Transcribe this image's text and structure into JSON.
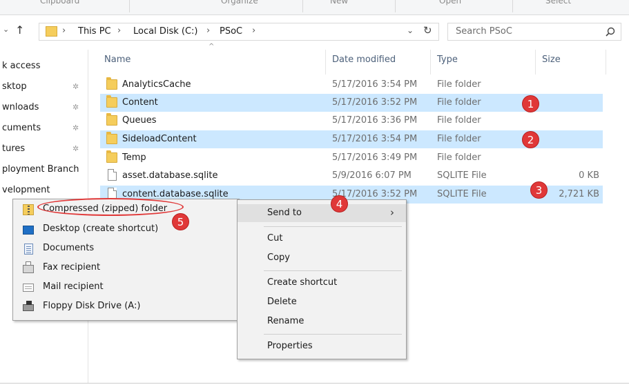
{
  "ribbon": {
    "groups": [
      "Clipboard",
      "Organize",
      "New",
      "Open",
      "Select"
    ]
  },
  "address": {
    "crumbs": [
      "This PC",
      "Local Disk (C:)",
      "PSoC"
    ],
    "separator": "›",
    "search_placeholder": "Search PSoC"
  },
  "nav": {
    "items": [
      "k access",
      "sktop",
      "wnloads",
      "cuments",
      "tures",
      "ployment Branch",
      "velopment"
    ]
  },
  "columns": {
    "name": "Name",
    "date": "Date modified",
    "type": "Type",
    "size": "Size"
  },
  "files": [
    {
      "name": "AnalyticsCache",
      "date": "5/17/2016 3:54 PM",
      "type": "File folder",
      "size": "",
      "kind": "folder",
      "selected": false
    },
    {
      "name": "Content",
      "date": "5/17/2016 3:52 PM",
      "type": "File folder",
      "size": "",
      "kind": "folder",
      "selected": true
    },
    {
      "name": "Queues",
      "date": "5/17/2016 3:36 PM",
      "type": "File folder",
      "size": "",
      "kind": "folder",
      "selected": false
    },
    {
      "name": "SideloadContent",
      "date": "5/17/2016 3:54 PM",
      "type": "File folder",
      "size": "",
      "kind": "folder",
      "selected": true
    },
    {
      "name": "Temp",
      "date": "5/17/2016 3:49 PM",
      "type": "File folder",
      "size": "",
      "kind": "folder",
      "selected": false
    },
    {
      "name": "asset.database.sqlite",
      "date": "5/9/2016 6:07 PM",
      "type": "SQLITE File",
      "size": "0 KB",
      "kind": "file",
      "selected": false
    },
    {
      "name": "content.database.sqlite",
      "date": "5/17/2016 3:52 PM",
      "type": "SQLITE File",
      "size": "2,721 KB",
      "kind": "file",
      "selected": true
    }
  ],
  "context_menu": {
    "send_to": "Send to",
    "cut": "Cut",
    "copy": "Copy",
    "create_shortcut": "Create shortcut",
    "delete": "Delete",
    "rename": "Rename",
    "properties": "Properties"
  },
  "send_to_menu": {
    "items": [
      "Compressed (zipped) folder",
      "Desktop (create shortcut)",
      "Documents",
      "Fax recipient",
      "Mail recipient",
      "Floppy Disk Drive (A:)"
    ]
  },
  "callouts": [
    "1",
    "2",
    "3",
    "4",
    "5"
  ],
  "colors": {
    "selection": "#cce8ff",
    "callout": "#e03838",
    "menu_bg": "#f2f2f2",
    "folder": "#f5cd5c"
  }
}
